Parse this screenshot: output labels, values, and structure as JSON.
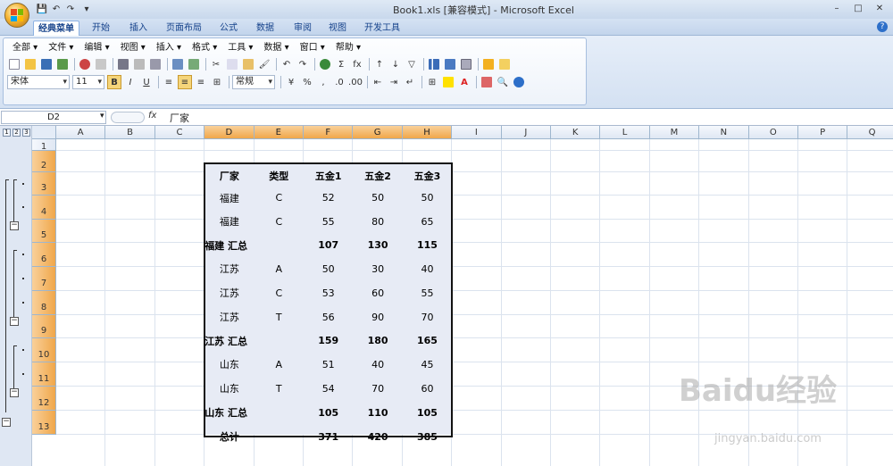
{
  "window": {
    "title": "Book1.xls  [兼容模式] - Microsoft Excel",
    "controls": [
      "–",
      "□",
      "✕"
    ]
  },
  "ribbon_tabs": [
    {
      "label": "经典菜单",
      "active": true
    },
    {
      "label": "开始"
    },
    {
      "label": "插入"
    },
    {
      "label": "页面布局"
    },
    {
      "label": "公式"
    },
    {
      "label": "数据"
    },
    {
      "label": "审阅"
    },
    {
      "label": "视图"
    },
    {
      "label": "开发工具"
    }
  ],
  "classic_menu": [
    "全部 ▾",
    "文件 ▾",
    "编辑 ▾",
    "视图 ▾",
    "插入 ▾",
    "格式 ▾",
    "工具 ▾",
    "数据 ▾",
    "窗口 ▾",
    "帮助 ▾"
  ],
  "format_toolbar": {
    "font": "宋体",
    "font_size": "11",
    "bold": "B",
    "italic": "I",
    "underline": "U",
    "number_format": "常规",
    "percent": "%",
    "comma": ",",
    "sum": "Σ",
    "fx": "fx"
  },
  "formula_bar": {
    "name_box": "D2",
    "fx_label": "fx",
    "content": "厂家"
  },
  "outline_levels": [
    "1",
    "2",
    "3"
  ],
  "columns": [
    "A",
    "B",
    "C",
    "D",
    "E",
    "F",
    "G",
    "H",
    "I",
    "J",
    "K",
    "L",
    "M",
    "N",
    "O",
    "P",
    "Q"
  ],
  "rows": [
    "1",
    "2",
    "3",
    "4",
    "5",
    "6",
    "7",
    "8",
    "9",
    "10",
    "11",
    "12",
    "13"
  ],
  "table": {
    "headers": [
      "厂家",
      "类型",
      "五金1",
      "五金2",
      "五金3"
    ],
    "rows": [
      {
        "cells": [
          "福建",
          "C",
          "52",
          "50",
          "50"
        ]
      },
      {
        "cells": [
          "福建",
          "C",
          "55",
          "80",
          "65"
        ]
      },
      {
        "cells": [
          "福建 汇总",
          "",
          "107",
          "130",
          "115"
        ],
        "subtotal": true
      },
      {
        "cells": [
          "江苏",
          "A",
          "50",
          "30",
          "40"
        ]
      },
      {
        "cells": [
          "江苏",
          "C",
          "53",
          "60",
          "55"
        ]
      },
      {
        "cells": [
          "江苏",
          "T",
          "56",
          "90",
          "70"
        ]
      },
      {
        "cells": [
          "江苏 汇总",
          "",
          "159",
          "180",
          "165"
        ],
        "subtotal": true
      },
      {
        "cells": [
          "山东",
          "A",
          "51",
          "40",
          "45"
        ]
      },
      {
        "cells": [
          "山东",
          "T",
          "54",
          "70",
          "60"
        ]
      },
      {
        "cells": [
          "山东 汇总",
          "",
          "105",
          "110",
          "105"
        ],
        "subtotal": true
      },
      {
        "cells": [
          "总计",
          "",
          "371",
          "420",
          "385"
        ],
        "subtotal": true
      }
    ]
  },
  "watermark": {
    "main": "Baidu经验",
    "sub": "jingyan.baidu.com"
  },
  "colors": {
    "selected_header": "#f0a74a",
    "selection_fill": "#e7ebf5",
    "ribbon_text": "#15428b"
  }
}
